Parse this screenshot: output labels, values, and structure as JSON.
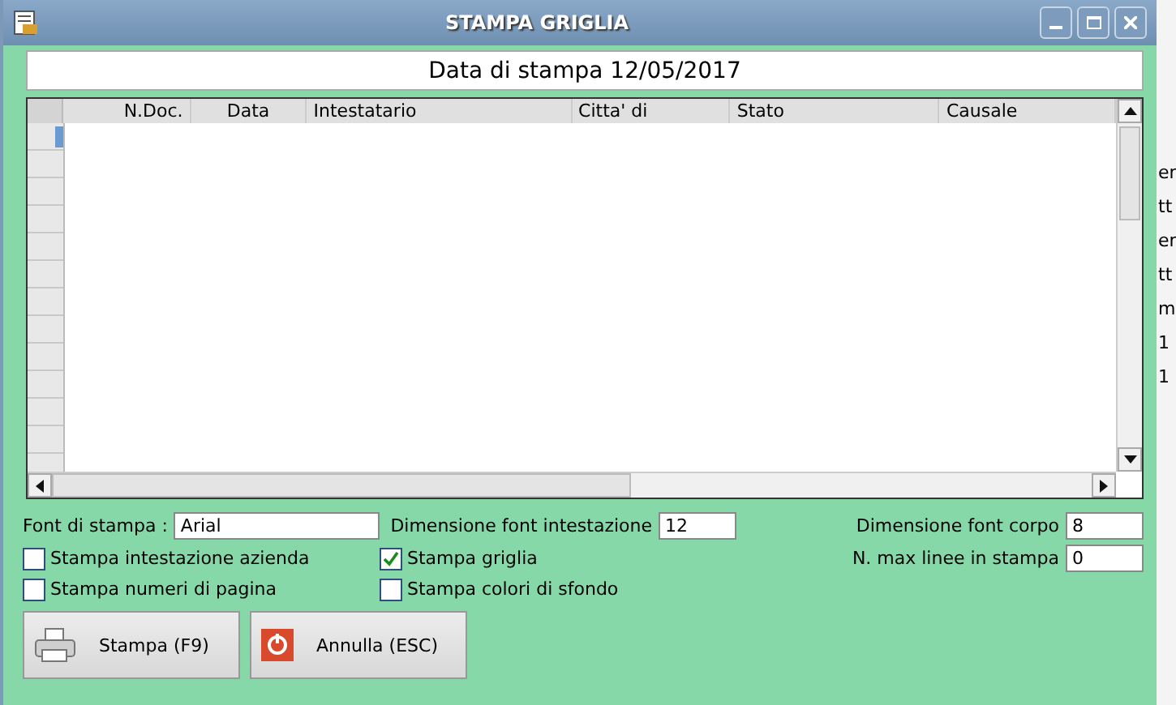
{
  "window": {
    "title": "STAMPA GRIGLIA"
  },
  "header_field": {
    "value": "Data di stampa 12/05/2017"
  },
  "table": {
    "columns": [
      "N.Doc.",
      "Data",
      "Intestatario",
      "Citta' di",
      "Stato",
      "Causale"
    ]
  },
  "font_field": {
    "label": "Font di stampa :",
    "value": "Arial"
  },
  "header_font_size": {
    "label": "Dimensione font intestazione",
    "value": "12"
  },
  "body_font_size": {
    "label": "Dimensione font corpo",
    "value": "8"
  },
  "max_lines": {
    "label": "N. max linee in stampa",
    "value": "0"
  },
  "options": [
    {
      "label": "Stampa intestazione azienda",
      "checked": false
    },
    {
      "label": "Stampa griglia",
      "checked": true
    },
    {
      "label": "Stampa numeri di pagina",
      "checked": false
    },
    {
      "label": "Stampa colori di sfondo",
      "checked": false
    }
  ],
  "buttons": [
    {
      "kind": "print",
      "label": "Stampa (F9)"
    },
    {
      "kind": "cancel",
      "label": "Annulla (ESC)"
    }
  ],
  "background_fragments": [
    "er",
    "tt",
    "er",
    "tt",
    "m",
    "1",
    "1"
  ]
}
